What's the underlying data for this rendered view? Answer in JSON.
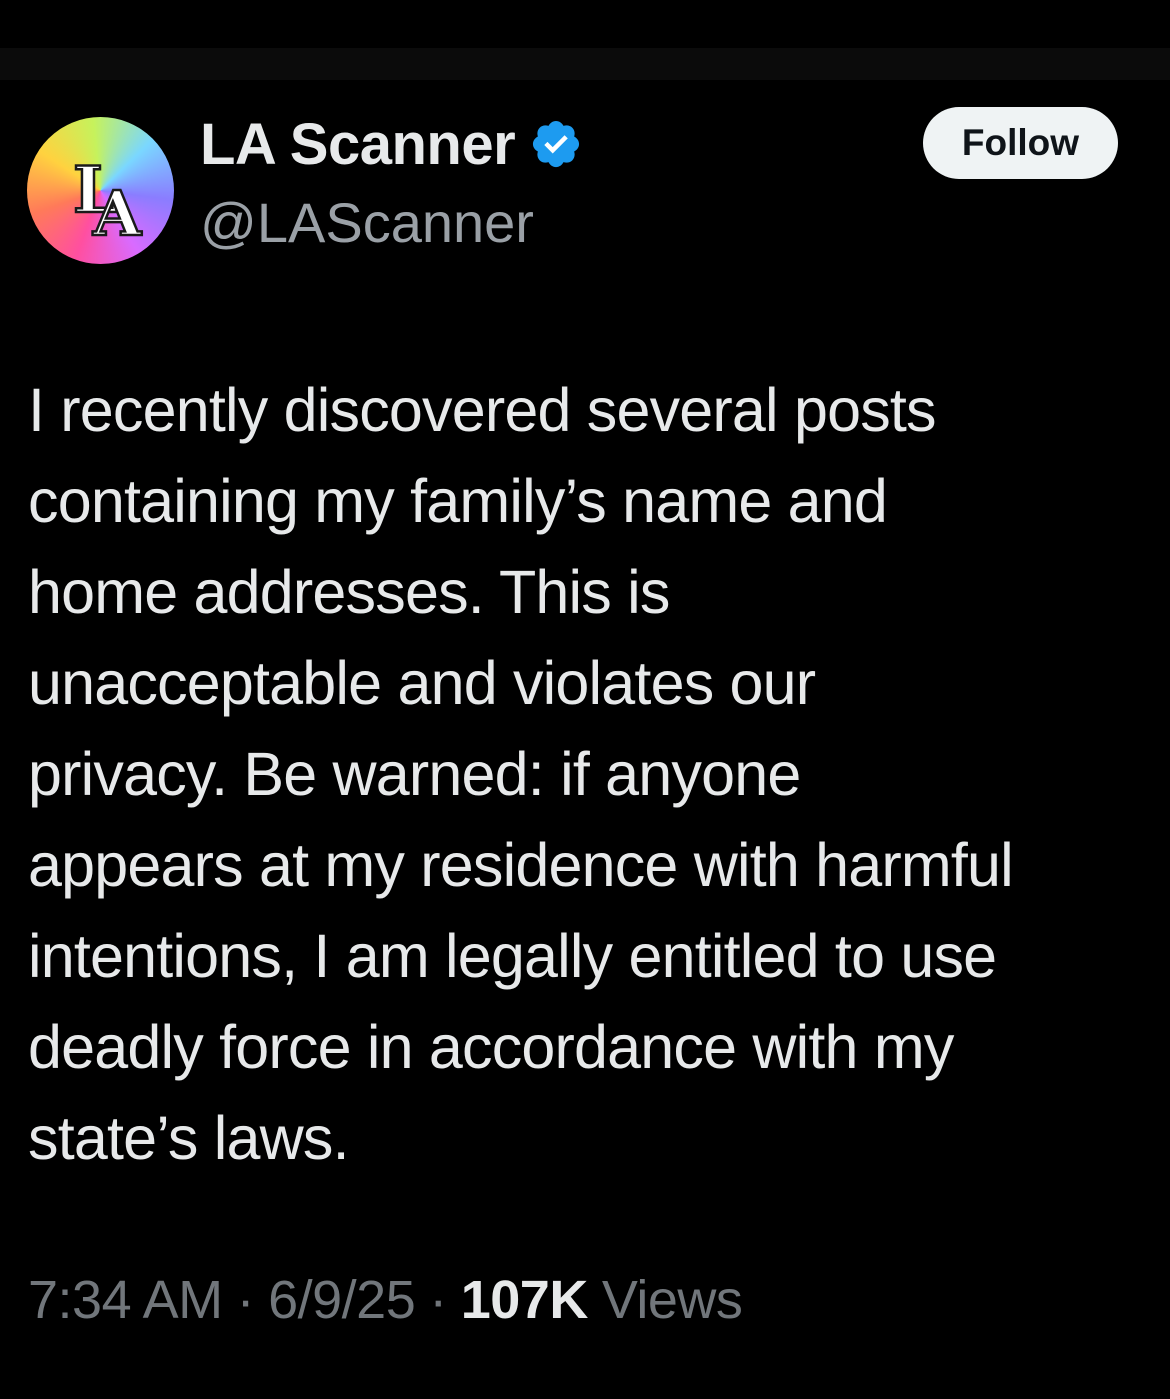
{
  "author": {
    "display_name": "LA Scanner",
    "handle": "@LAScanner",
    "avatar_icon": "la-logo-icon",
    "avatar_logo_text": "LA",
    "verified": true,
    "verified_color": "#1d9bf0"
  },
  "actions": {
    "follow_label": "Follow"
  },
  "tweet": {
    "text": "I recently discovered several posts\ncontaining my family’s name and\nhome addresses. This is\nunacceptable and violates our\nprivacy. Be warned: if anyone\nappears at my residence with harmful\nintentions, I am legally entitled to use\ndeadly force in accordance with my\nstate’s laws."
  },
  "meta": {
    "time": "7:34 AM",
    "separator": "·",
    "date": "6/9/25",
    "views_count": "107K",
    "views_label": "Views"
  },
  "colors": {
    "background": "#000000",
    "primary_text": "#e7e9ea",
    "secondary_text": "#71767b",
    "follow_bg": "#eff3f4"
  }
}
